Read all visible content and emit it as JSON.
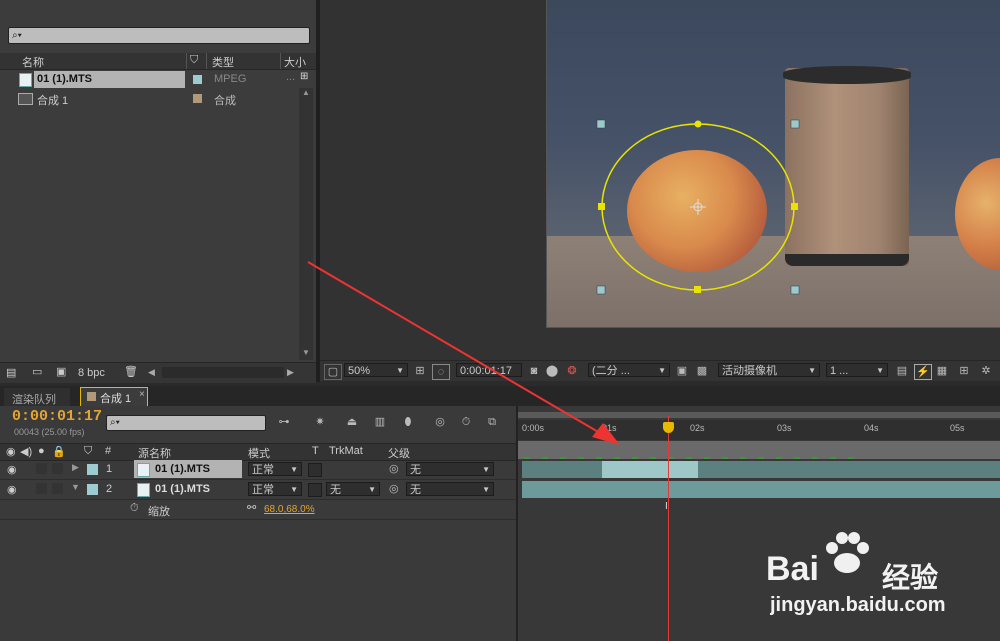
{
  "project": {
    "search_placeholder": "",
    "search_glyph": "⌕▾",
    "columns": {
      "name": "名称",
      "type": "类型",
      "size": "大小"
    },
    "items": [
      {
        "name": "01 (1).MTS",
        "type": "MPEG",
        "size": "...",
        "color": "#9ccbd0"
      },
      {
        "name": "合成 1",
        "type": "合成",
        "size": "",
        "color": "#b09a7a"
      }
    ],
    "bpc": "8 bpc"
  },
  "viewer": {
    "zoom": "50%",
    "timecode": "0:00:01:17",
    "resolution": "(二分 ...",
    "camera": "活动摄像机",
    "views": "1 ..."
  },
  "timeline": {
    "tabs": [
      {
        "label": "渲染队列"
      },
      {
        "label": "合成 1"
      }
    ],
    "current_time": "0:00:01:17",
    "frame_info": "00043 (25.00 fps)",
    "search_glyph": "⌕▾",
    "headers": {
      "num": "#",
      "source": "源名称",
      "mode": "模式",
      "t": "T",
      "trkmat": "TrkMat",
      "parent": "父级"
    },
    "layers": [
      {
        "num": "1",
        "name": "01 (1).MTS",
        "mode": "正常",
        "trkmat": "",
        "parent": "无"
      },
      {
        "num": "2",
        "name": "01 (1).MTS",
        "mode": "正常",
        "trkmat": "无",
        "parent": "无"
      }
    ],
    "property": {
      "name": "缩放",
      "value": "68.0,68.0%"
    },
    "ruler": [
      "0:00s",
      "01s",
      "02s",
      "03s",
      "04s",
      "05s"
    ]
  },
  "watermark": {
    "brand": "Bai",
    "brand2": "经验",
    "url": "jingyan.baidu.com"
  }
}
